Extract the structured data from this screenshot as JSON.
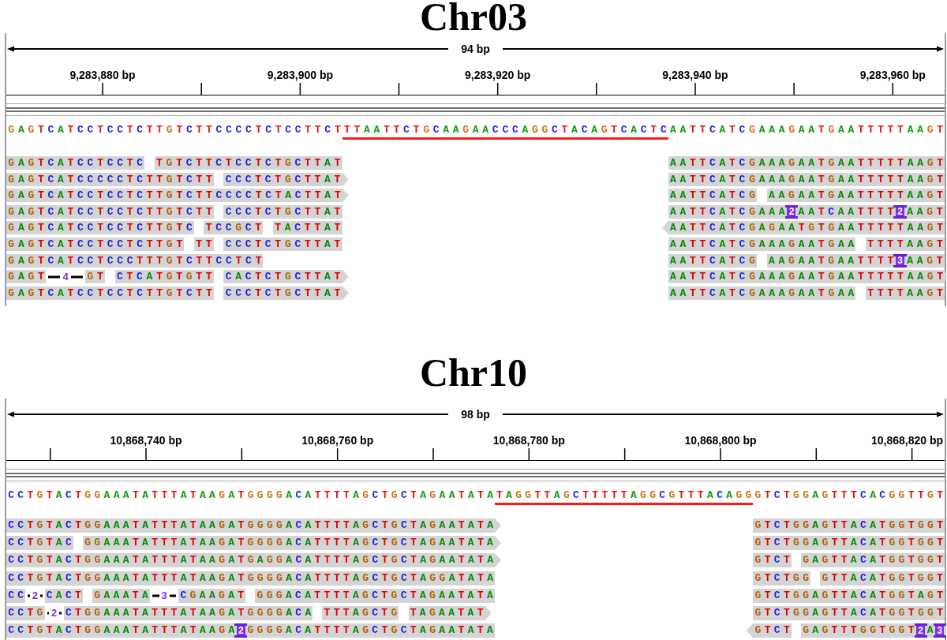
{
  "panels": [
    {
      "title": "Chr03",
      "span_label": "94 bp",
      "tick_labels": [
        "9,283,880 bp",
        "9,283,900 bp",
        "9,283,920 bp",
        "9,283,940 bp",
        "9,283,960 bp"
      ],
      "reference": {
        "before": "GAGTCATCCTCCTCTTGTCTTCCCCTCTCCTTCT",
        "target": "TTAATTCTGCAAGAACCCAGGCTACAGTCACTC",
        "after": "AATTCATCGAAAGAATGAATTTTTAAGT"
      },
      "reads": [
        {
          "alignments": [
            {
              "kind": "plain",
              "pieces": [
                {
                  "kind": "bases",
                  "text": "GAGTCATCCTCCTC"
                },
                {
                  "kind": "gap"
                },
                {
                  "kind": "bases",
                  "text": "TGTCTTCTCCTCTGCTTAT"
                }
              ]
            },
            {
              "kind": "plain",
              "pieces": [
                {
                  "kind": "bases",
                  "text": "AATTCATCGAAAGAATGAATTTTTAAGT"
                }
              ]
            }
          ]
        },
        {
          "alignments": [
            {
              "kind": "forward",
              "pieces": [
                {
                  "kind": "bases",
                  "text": "GAGTCATCCCCCTCTTGTCTT"
                },
                {
                  "kind": "gap"
                },
                {
                  "kind": "bases",
                  "text": "CCCTCTGCTTAT"
                }
              ]
            },
            {
              "kind": "plain",
              "pieces": [
                {
                  "kind": "bases",
                  "text": "AATTCATCGAAAGAATGAATTTTTAAGT"
                }
              ]
            }
          ]
        },
        {
          "alignments": [
            {
              "kind": "forward",
              "pieces": [
                {
                  "kind": "bases",
                  "text": "GAGTCATCCTCCTCTTGTCTTCCCCTCTACTTAT"
                }
              ]
            },
            {
              "kind": "plain",
              "pieces": [
                {
                  "kind": "bases",
                  "text": "AATTCATCG"
                },
                {
                  "kind": "gap"
                },
                {
                  "kind": "bases",
                  "text": "AAGAATGAATTTTTAAGT"
                }
              ]
            }
          ]
        },
        {
          "alignments": [
            {
              "kind": "plain",
              "pieces": [
                {
                  "kind": "bases",
                  "text": "GAGTCATCCTCCTCTTGTCTT"
                },
                {
                  "kind": "gap"
                },
                {
                  "kind": "bases",
                  "text": "CCCTCTGCTTAT"
                }
              ]
            },
            {
              "kind": "plain",
              "pieces": [
                {
                  "kind": "bases",
                  "text": "AATTCATCGAAA"
                },
                {
                  "kind": "insertion",
                  "label": "2"
                },
                {
                  "kind": "bases",
                  "text": "AATCAATTTT"
                },
                {
                  "kind": "insertion",
                  "label": "2"
                },
                {
                  "kind": "bases",
                  "text": "AAGT"
                }
              ]
            }
          ]
        },
        {
          "alignments": [
            {
              "kind": "plain",
              "pieces": [
                {
                  "kind": "bases",
                  "text": "GAGTCATCCTCCTCTTGTC"
                },
                {
                  "kind": "gap"
                },
                {
                  "kind": "bases",
                  "text": "TCCGCT"
                },
                {
                  "kind": "gap"
                },
                {
                  "kind": "bases",
                  "text": "TACTTAT"
                }
              ]
            },
            {
              "kind": "reverse",
              "pieces": [
                {
                  "kind": "bases",
                  "text": "AATTCATCGAGAATGTGAATTTTTAAGT"
                }
              ]
            }
          ]
        },
        {
          "alignments": [
            {
              "kind": "plain",
              "pieces": [
                {
                  "kind": "bases",
                  "text": "GAGTCATCCTCCTCTTGT"
                },
                {
                  "kind": "gap"
                },
                {
                  "kind": "bases",
                  "text": "TT"
                },
                {
                  "kind": "gap"
                },
                {
                  "kind": "bases",
                  "text": "CCCTCTGCTTAT"
                }
              ]
            },
            {
              "kind": "plain",
              "pieces": [
                {
                  "kind": "bases",
                  "text": "AATTCATCGAAAGAATGAA"
                },
                {
                  "kind": "gap"
                },
                {
                  "kind": "bases",
                  "text": "TTTTAAGT"
                }
              ]
            }
          ]
        },
        {
          "alignments": [
            {
              "kind": "plain",
              "pieces": [
                {
                  "kind": "bases",
                  "text": "GAGTCATCCTCCCTTTGTCTTCCTCT"
                }
              ]
            },
            {
              "kind": "plain",
              "pieces": [
                {
                  "kind": "bases",
                  "text": "AATTCATCG"
                },
                {
                  "kind": "gap"
                },
                {
                  "kind": "bases",
                  "text": "AAGAATGAATTTT"
                },
                {
                  "kind": "insertion",
                  "label": "3"
                },
                {
                  "kind": "bases",
                  "text": "AAGT"
                }
              ]
            }
          ]
        },
        {
          "alignments": [
            {
              "kind": "forward",
              "pieces": [
                {
                  "kind": "bases",
                  "text": "GAGT"
                },
                {
                  "kind": "deletion",
                  "label": "4"
                },
                {
                  "kind": "bases",
                  "text": "GT"
                },
                {
                  "kind": "gap"
                },
                {
                  "kind": "bases",
                  "text": "CTCATGTGTT"
                },
                {
                  "kind": "gap"
                },
                {
                  "kind": "bases",
                  "text": "CACTCTGCTTAT"
                }
              ]
            },
            {
              "kind": "forward",
              "pieces": [
                {
                  "kind": "bases",
                  "text": "AATTCATCGAAAGAATGAATTTTTAAGT"
                }
              ]
            }
          ]
        },
        {
          "alignments": [
            {
              "kind": "forward",
              "pieces": [
                {
                  "kind": "bases",
                  "text": "GAGTCATCCTCCTCTTGTCTT"
                },
                {
                  "kind": "gap"
                },
                {
                  "kind": "bases",
                  "text": "CCCTCTGCTTAT"
                }
              ]
            },
            {
              "kind": "plain",
              "pieces": [
                {
                  "kind": "bases",
                  "text": "AATTCATCGAAAGAATGAA"
                },
                {
                  "kind": "gap"
                },
                {
                  "kind": "bases",
                  "text": "TTTTAAGT"
                }
              ]
            }
          ]
        }
      ]
    },
    {
      "title": "Chr10",
      "span_label": "98 bp",
      "tick_labels": [
        "10,868,740 bp",
        "10,868,760 bp",
        "10,868,780 bp",
        "10,868,800 bp",
        "10,868,820 bp"
      ],
      "reference": {
        "before": "CCTGTACTGGAAATATTTATAAGATGGGGACATTTTAGCTGCTAGAATATA",
        "target": "TAGGTTAGCTTTTTAGGCGTTTACAGG",
        "after": "GTCTGGAGTTTCACGGTTGT"
      },
      "reads": [
        {
          "alignments": [
            {
              "kind": "forward",
              "pieces": [
                {
                  "kind": "bases",
                  "text": "CCTGTACTGGAAATATTTATAAGATGGGGACATTTTAGCTGCTAGAATATA"
                }
              ]
            },
            {
              "kind": "plain",
              "pieces": [
                {
                  "kind": "bases",
                  "text": "GTCTGGAGTTACATGGTGGT"
                }
              ]
            }
          ]
        },
        {
          "alignments": [
            {
              "kind": "forward",
              "pieces": [
                {
                  "kind": "bases",
                  "text": "CCTGTAC"
                },
                {
                  "kind": "gap"
                },
                {
                  "kind": "bases",
                  "text": "GGAAATATTTATAAGATGGGGACATTTTAGCTGCTAGAATATA"
                }
              ]
            },
            {
              "kind": "plain",
              "pieces": [
                {
                  "kind": "bases",
                  "text": "GTCTGGAGTTACATGGTGGT"
                }
              ]
            }
          ]
        },
        {
          "alignments": [
            {
              "kind": "forward",
              "pieces": [
                {
                  "kind": "bases",
                  "text": "CCTGTACTGGAAATATTTATAAGATGAGGACATTTTAGCTGCTAGAATATA"
                }
              ]
            },
            {
              "kind": "plain",
              "pieces": [
                {
                  "kind": "bases",
                  "text": "GTCT"
                },
                {
                  "kind": "gap"
                },
                {
                  "kind": "bases",
                  "text": "GAGTTACATGGTGGT"
                }
              ]
            }
          ]
        },
        {
          "alignments": [
            {
              "kind": "plain",
              "pieces": [
                {
                  "kind": "bases",
                  "text": "CCTGTACTGGAAATATTTATAAGATGGGGACATTTTAGCTGCTAGGATATA"
                }
              ]
            },
            {
              "kind": "plain",
              "pieces": [
                {
                  "kind": "bases",
                  "text": "GTCTGG"
                },
                {
                  "kind": "gap"
                },
                {
                  "kind": "bases",
                  "text": "GTTACATGGTGGT"
                }
              ]
            }
          ]
        },
        {
          "alignments": [
            {
              "kind": "plain",
              "pieces": [
                {
                  "kind": "bases",
                  "text": "CC"
                },
                {
                  "kind": "deletion",
                  "label": "2"
                },
                {
                  "kind": "bases",
                  "text": "CACT"
                },
                {
                  "kind": "gap"
                },
                {
                  "kind": "bases",
                  "text": "GAAATA"
                },
                {
                  "kind": "deletion",
                  "label": "3"
                },
                {
                  "kind": "bases",
                  "text": "CGAAGAT"
                },
                {
                  "kind": "gap"
                },
                {
                  "kind": "bases",
                  "text": "GGGACATTTTAGCTGCTAGAATATA"
                }
              ]
            },
            {
              "kind": "plain",
              "pieces": [
                {
                  "kind": "bases",
                  "text": "GTCTGGAGTTACATGGTAGT"
                }
              ]
            }
          ]
        },
        {
          "alignments": [
            {
              "kind": "forward",
              "pieces": [
                {
                  "kind": "bases",
                  "text": "CCTG"
                },
                {
                  "kind": "deletion",
                  "label": "2"
                },
                {
                  "kind": "bases",
                  "text": "CTGGAAATATTTATAAGATGGGGACA"
                },
                {
                  "kind": "gap"
                },
                {
                  "kind": "bases",
                  "text": "TTTAGCTG"
                },
                {
                  "kind": "gap"
                },
                {
                  "kind": "bases",
                  "text": "TAGAATAT"
                }
              ]
            },
            {
              "kind": "plain",
              "pieces": [
                {
                  "kind": "bases",
                  "text": "GTCTGGAGTTACATGGTGGT"
                }
              ]
            }
          ]
        },
        {
          "alignments": [
            {
              "kind": "plain",
              "pieces": [
                {
                  "kind": "bases",
                  "text": "CCTGTACTGGAAATATTTATAAGA"
                },
                {
                  "kind": "insertion",
                  "label": "2"
                },
                {
                  "kind": "bases",
                  "text": "GGGGACATTTTAGCTGCTAGAATATA"
                }
              ]
            },
            {
              "kind": "reverse",
              "pieces": [
                {
                  "kind": "bases",
                  "text": "GTCT"
                },
                {
                  "kind": "gap"
                },
                {
                  "kind": "bases",
                  "text": "GAGTTTGGTGGT"
                },
                {
                  "kind": "insertion",
                  "label": "2"
                },
                {
                  "kind": "bases",
                  "text": "A"
                },
                {
                  "kind": "insertion",
                  "label": "3"
                }
              ]
            }
          ]
        }
      ]
    }
  ]
}
